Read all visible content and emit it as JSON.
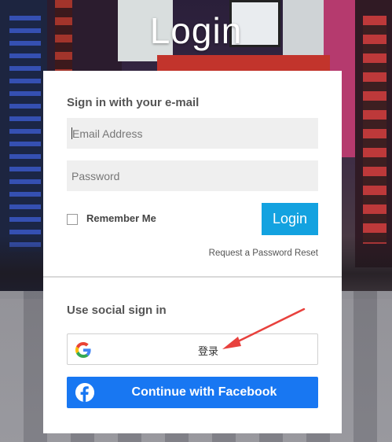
{
  "page": {
    "title": "Login"
  },
  "email_section": {
    "heading": "Sign in with your e-mail",
    "email_placeholder": "Email Address",
    "password_placeholder": "Password",
    "remember_label": "Remember Me",
    "login_label": "Login",
    "reset_link": "Request a Password Reset"
  },
  "social_section": {
    "heading": "Use social sign in",
    "google_label": "登录",
    "facebook_label": "Continue with Facebook"
  },
  "colors": {
    "login_button": "#13a2e0",
    "facebook_button": "#1877f2",
    "annotation_arrow": "#e8413d"
  },
  "icons": {
    "google": "google-g-icon",
    "facebook": "facebook-f-icon",
    "annotation": "red-arrow-icon"
  }
}
